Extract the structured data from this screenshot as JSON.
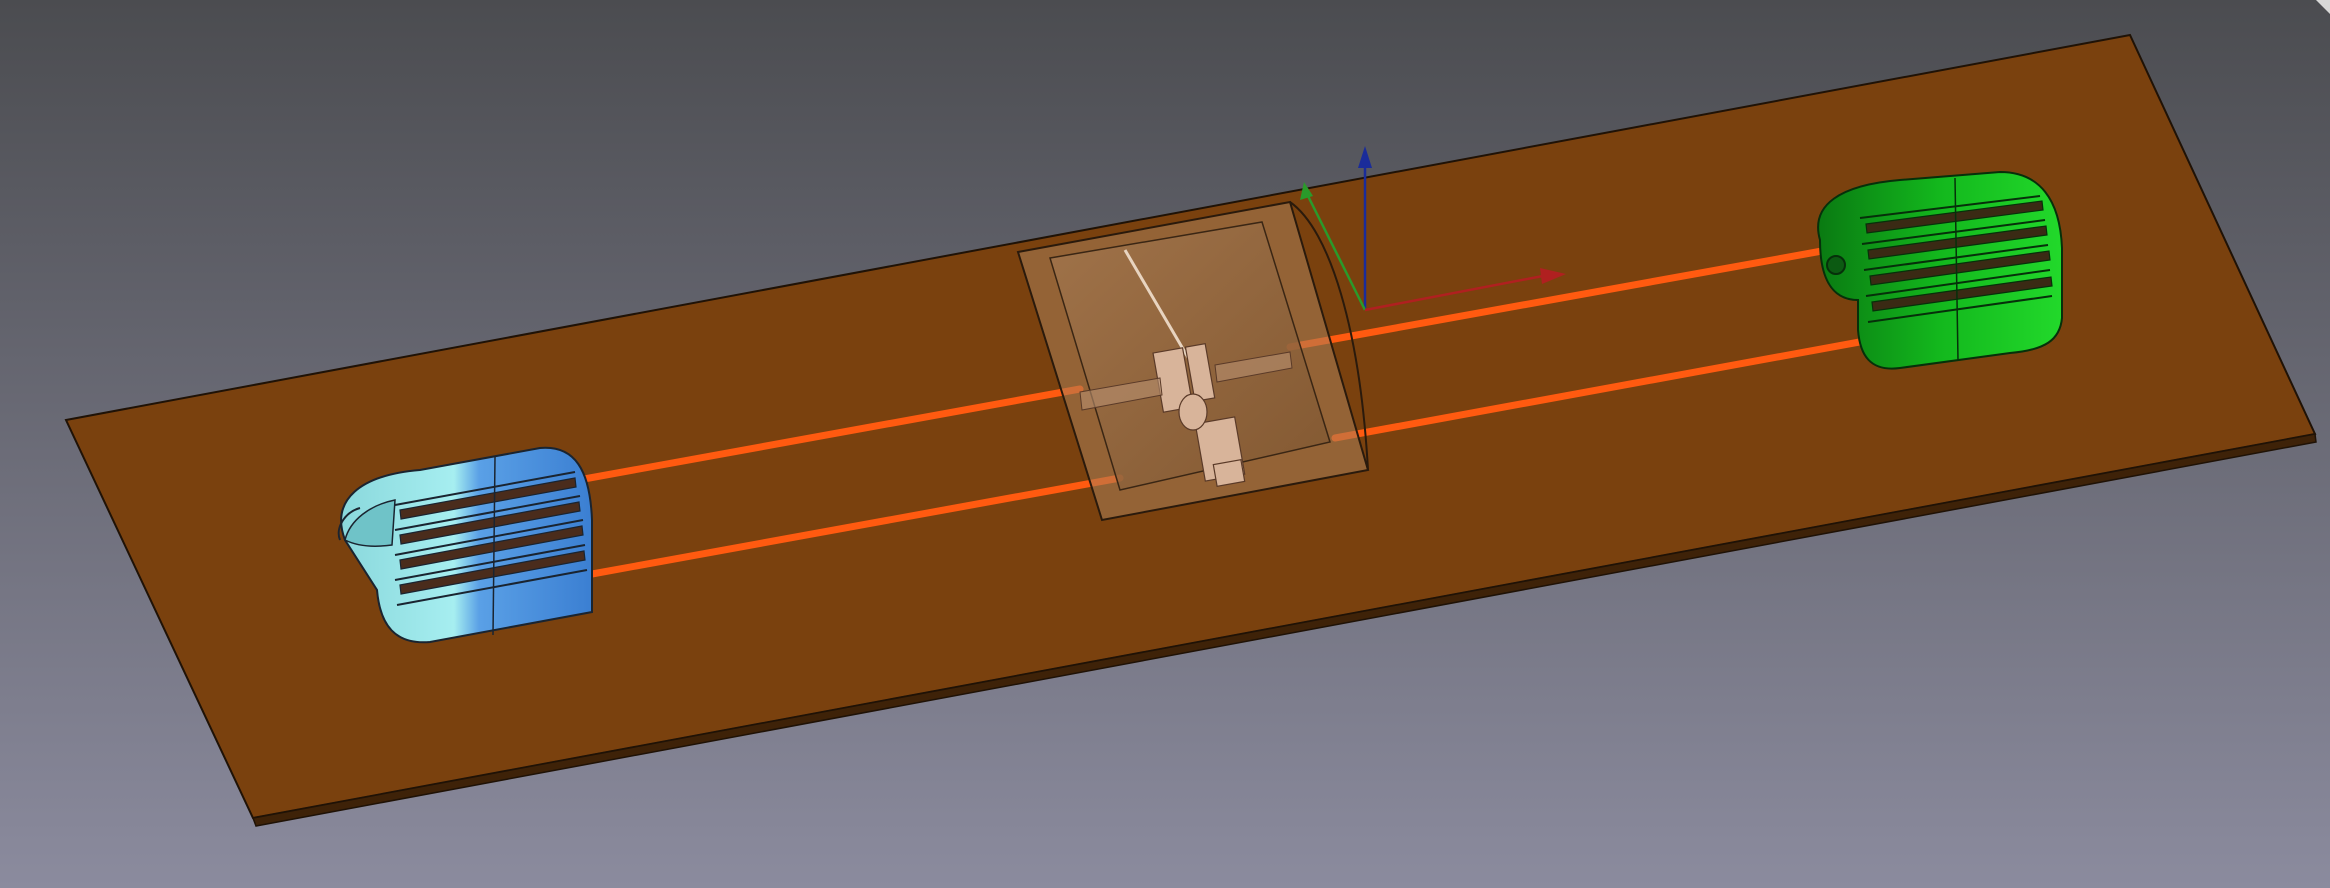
{
  "viewport": {
    "background_top": "#4b4c50",
    "background_bottom": "#8b8b9e"
  },
  "scene": {
    "base_plate_color": "#7a410e",
    "base_plate_edge": "#2a1a08",
    "rail_color": "#ff5a10",
    "left_housing_colors": [
      "#9fe7ea",
      "#4a90e0"
    ],
    "right_housing_color": "#11b51b",
    "center_box_color": "#c49a6e"
  },
  "axis_triad": {
    "x_color": "#b02020",
    "y_color": "#2a9a2a",
    "z_color": "#1a2c9a"
  },
  "icons": {
    "corner": "corner-resize-icon"
  }
}
